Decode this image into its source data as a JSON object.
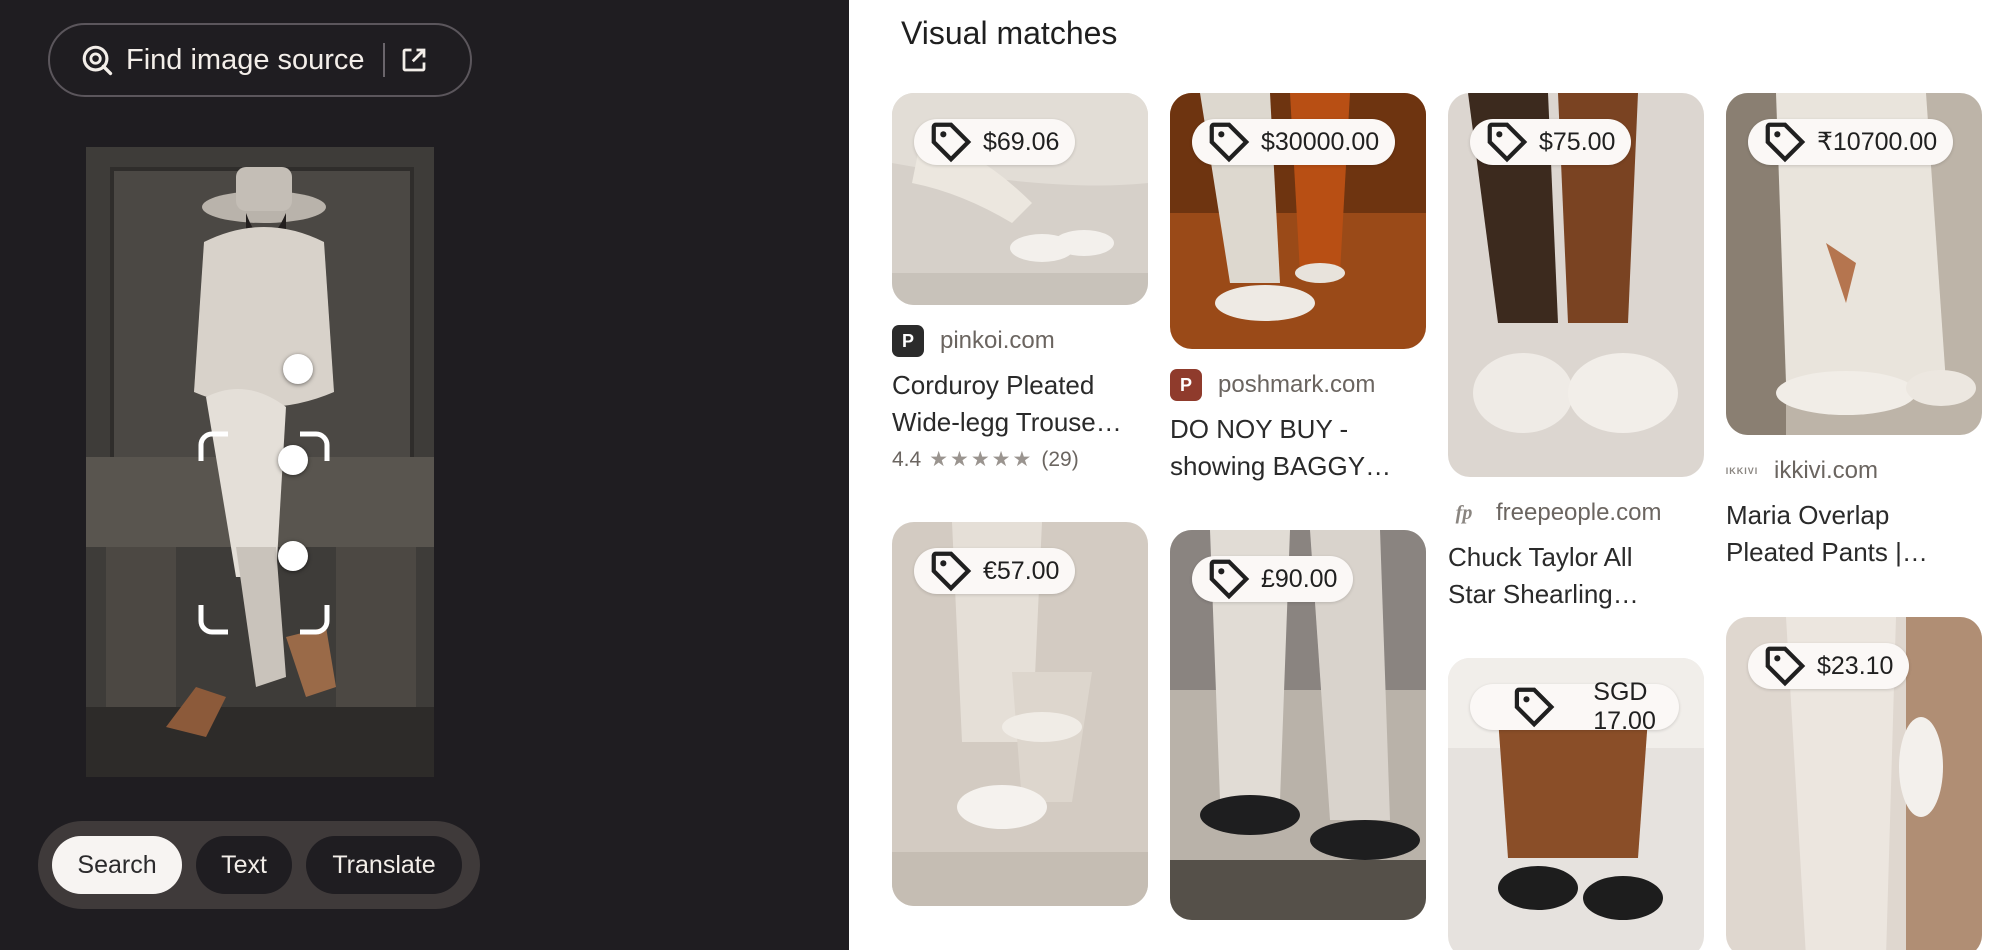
{
  "find_source": {
    "label": "Find image source"
  },
  "modes": [
    "Search",
    "Text",
    "Translate"
  ],
  "results_title": "Visual matches",
  "results": [
    {
      "price": "$69.06",
      "site": "pinkoi.com",
      "title_line1": "Corduroy Pleated",
      "title_line2": "Wide-legg Trouse…",
      "rating": "4.4",
      "stars": "★★★★★",
      "reviews": "(29)"
    },
    {
      "price": "$30000.00",
      "site": "poshmark.com",
      "title_line1": "DO NOY BUY -",
      "title_line2": "showing BAGGY…"
    },
    {
      "price": "$75.00",
      "site": "freepeople.com",
      "title_line1": "Chuck Taylor All",
      "title_line2": "Star Shearling…"
    },
    {
      "price": "₹10700.00",
      "site": "ikkivi.com",
      "title_line1": "Maria Overlap",
      "title_line2": "Pleated Pants |…"
    },
    {
      "price": "€57.00"
    },
    {
      "price": "£90.00"
    },
    {
      "price": "SGD 17.00"
    },
    {
      "price": "$23.10"
    }
  ],
  "colors": {
    "left_bg": "#1f1d21",
    "chip_bar": "#3f3a3a",
    "active_chip": "#f7f4f2"
  }
}
